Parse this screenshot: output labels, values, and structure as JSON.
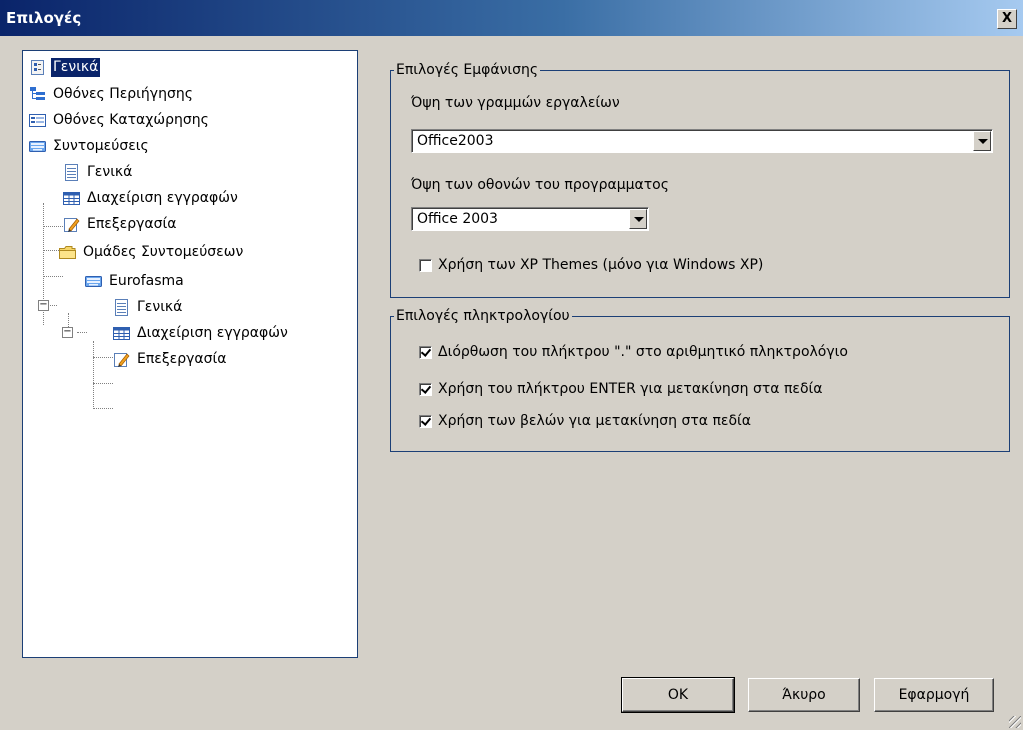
{
  "window": {
    "title": "Επιλογές",
    "close_label": "X"
  },
  "tree": {
    "items": [
      {
        "label": "Γενικά",
        "icon": "settings-page-icon"
      },
      {
        "label": "Οθόνες Περιήγησης",
        "icon": "tree-icon"
      },
      {
        "label": "Οθόνες Καταχώρησης",
        "icon": "form-icon"
      },
      {
        "label": "Συντομεύσεις",
        "icon": "keyboard-icon"
      },
      {
        "label": "Γενικά",
        "icon": "page-icon"
      },
      {
        "label": "Διαχείριση εγγραφών",
        "icon": "grid-icon"
      },
      {
        "label": "Επεξεργασία",
        "icon": "edit-icon"
      },
      {
        "label": "Ομάδες Συντομεύσεων",
        "icon": "folder-icon"
      },
      {
        "label": "Eurofasma",
        "icon": "keyboard-icon"
      },
      {
        "label": "Γενικά",
        "icon": "page-icon"
      },
      {
        "label": "Διαχείριση εγγραφών",
        "icon": "grid-icon"
      },
      {
        "label": "Επεξεργασία",
        "icon": "edit-icon"
      }
    ],
    "expander_minus": "−"
  },
  "display": {
    "legend": "Επιλογές Εμφάνισης",
    "toolbars_label": "Όψη των γραμμών εργαλείων",
    "toolbars_value": "Office2003",
    "screens_label": "Όψη των οθονών του προγραμματος",
    "screens_value": "Office 2003",
    "xp_themes_label": "Χρήση των XP Themes (μόνο για Windows XP)",
    "xp_themes_checked": false
  },
  "keyboard": {
    "legend": "Επιλογές πληκτρολογίου",
    "options": [
      {
        "label": "Διόρθωση του πλήκτρου \".\" στο αριθμητικό πληκτρολόγιο",
        "checked": true
      },
      {
        "label": "Χρήση του πλήκτρου ENTER για μετακίνηση στα πεδία",
        "checked": true
      },
      {
        "label": "Χρήση των βελών για μετακίνηση στα πεδία",
        "checked": true
      }
    ]
  },
  "buttons": {
    "ok": "OK",
    "cancel": "Άκυρο",
    "apply": "Εφαρμογή"
  }
}
